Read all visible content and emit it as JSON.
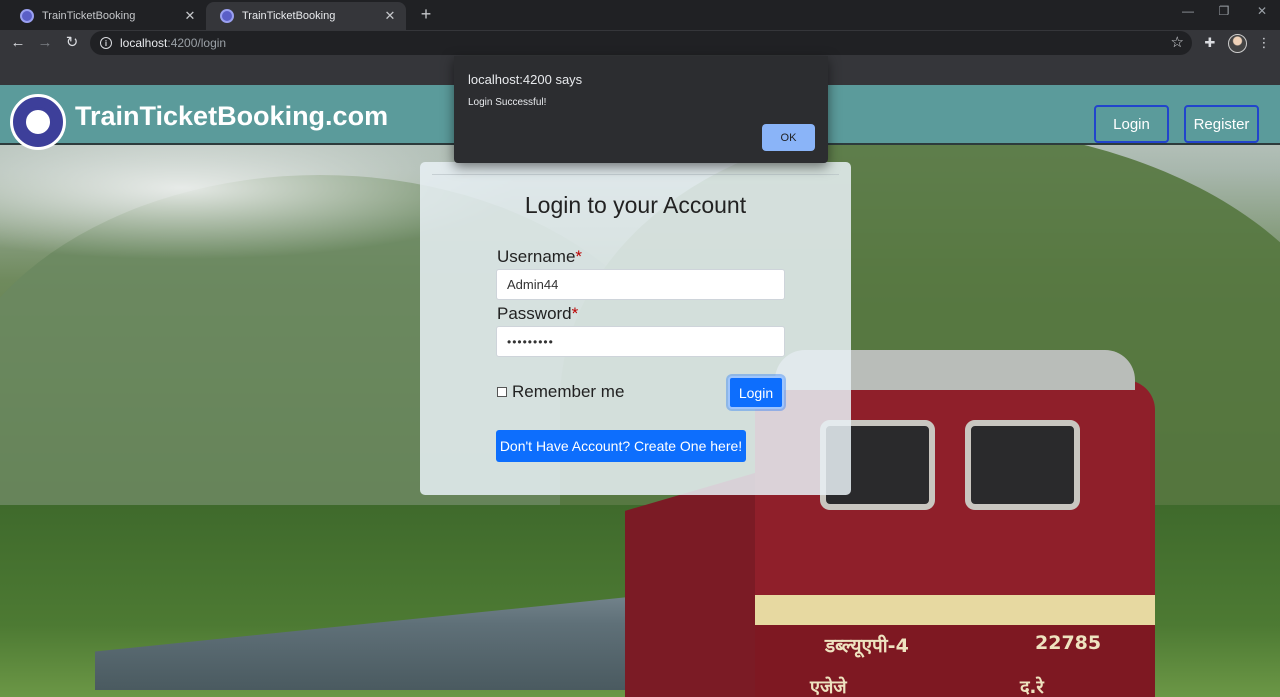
{
  "browser": {
    "tabs": [
      {
        "title": "TrainTicketBooking",
        "active": false
      },
      {
        "title": "TrainTicketBooking",
        "active": true
      }
    ],
    "new_tab_icon": "plus-icon",
    "url_host": "localhost",
    "url_path": ":4200/login"
  },
  "header": {
    "brand": "TrainTicketBooking.com",
    "login_label": "Login",
    "register_label": "Register"
  },
  "login_card": {
    "title": "Login to your Account",
    "username_label": "Username",
    "username_value": "Admin44",
    "password_label": "Password",
    "password_value": "•••••••••",
    "required_mark": "*",
    "remember_label": "Remember me",
    "login_button": "Login",
    "create_account_button": "Don't Have Account? Create One here!"
  },
  "background_photo": {
    "loco_number": "22785",
    "loco_class": "डब्ल्यूएपी-4",
    "left_marking": "एजेजे",
    "right_marking": "द.रे"
  },
  "alert": {
    "title": "localhost:4200 says",
    "message": "Login Successful!",
    "ok_label": "OK"
  },
  "colors": {
    "header_bg": "#5b9b9b",
    "primary": "#0d6efd",
    "dialog_bg": "#2c2d30",
    "dialog_ok": "#8ab4f8"
  }
}
